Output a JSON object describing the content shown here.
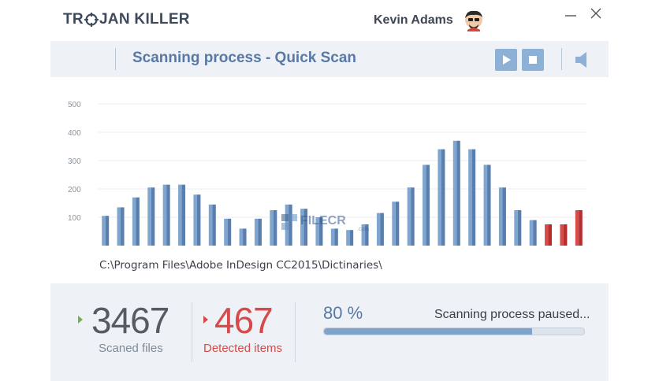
{
  "app": {
    "logo_left": "TR",
    "logo_right": "JAN KILLER",
    "user_name": "Kevin Adams"
  },
  "header": {
    "title": "Scanning process - Quick Scan",
    "icons": [
      "play-icon",
      "stop-icon",
      "speaker-icon"
    ]
  },
  "chart_data": {
    "type": "bar",
    "ylim": [
      0,
      500
    ],
    "yticks": [
      "100",
      "200",
      "300",
      "400",
      "500"
    ],
    "grid": true,
    "values": [
      105,
      135,
      170,
      205,
      215,
      215,
      180,
      145,
      95,
      60,
      95,
      125,
      145,
      130,
      100,
      60,
      55,
      75,
      115,
      155,
      205,
      285,
      340,
      370,
      340,
      285,
      205,
      125,
      90,
      75,
      75,
      125
    ],
    "detected_from_index": 29,
    "colors": {
      "normal": "#7fa6d0",
      "normal_dark": "#5a7fae",
      "detected": "#d94a4a",
      "detected_dark": "#b62f2f"
    }
  },
  "scan_path": "C:\\Program Files\\Adobe InDesign CC2015\\Dictinaries\\",
  "stats": {
    "scanned_count": "3467",
    "scanned_label": "Scaned files",
    "detected_count": "467",
    "detected_label": "Detected items",
    "percent_label": "80 %",
    "progress": 0.8,
    "status": "Scanning process paused..."
  },
  "watermark": {
    "text": "FILECR",
    "sub": ".com"
  }
}
